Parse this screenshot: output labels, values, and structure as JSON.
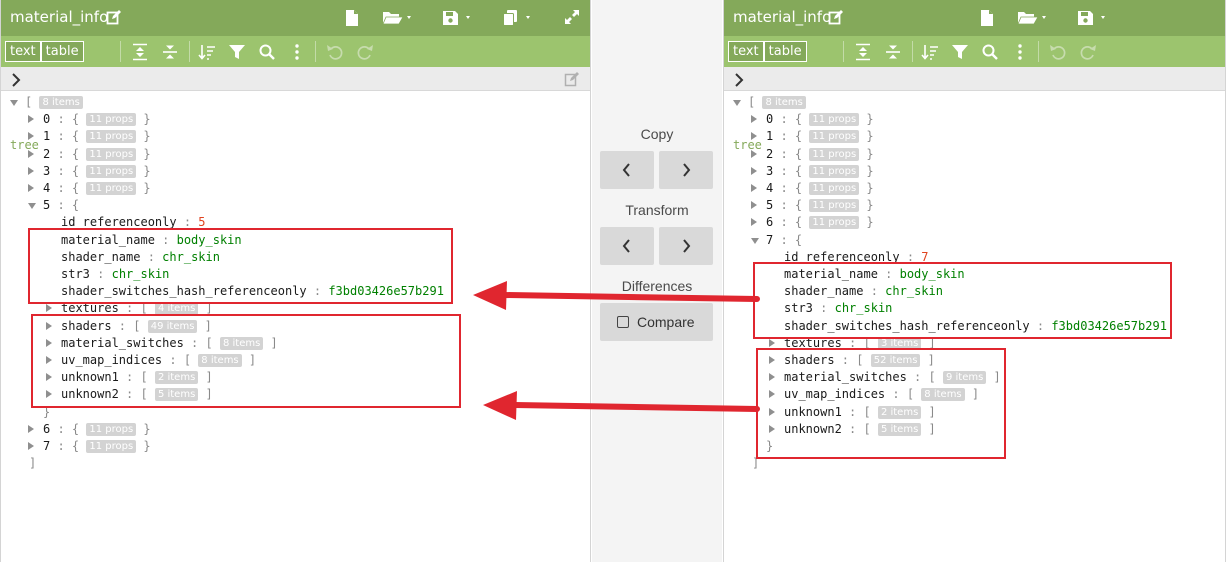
{
  "left": {
    "title": "material_info",
    "modes": {
      "text": "text",
      "tree": "tree",
      "table": "table"
    },
    "root_count": "8 items",
    "items_collapsed_before": [
      {
        "key": "0",
        "badge": "11 props"
      },
      {
        "key": "1",
        "badge": "11 props"
      },
      {
        "key": "2",
        "badge": "11 props"
      },
      {
        "key": "3",
        "badge": "11 props"
      },
      {
        "key": "4",
        "badge": "11 props"
      }
    ],
    "expanded": {
      "key": "5",
      "fields": [
        {
          "key": "id_referenceonly",
          "value": "5",
          "type": "num"
        },
        {
          "key": "material_name",
          "value": "body_skin",
          "type": "str"
        },
        {
          "key": "shader_name",
          "value": "chr_skin",
          "type": "str"
        },
        {
          "key": "str3",
          "value": "chr_skin",
          "type": "str"
        },
        {
          "key": "shader_switches_hash_referenceonly",
          "value": "f3bd03426e57b291",
          "type": "str"
        }
      ],
      "arrays": [
        {
          "key": "textures",
          "badge": "4 items"
        },
        {
          "key": "shaders",
          "badge": "49 items"
        },
        {
          "key": "material_switches",
          "badge": "8 items"
        },
        {
          "key": "uv_map_indices",
          "badge": "8 items"
        },
        {
          "key": "unknown1",
          "badge": "2 items"
        },
        {
          "key": "unknown2",
          "badge": "5 items"
        }
      ]
    },
    "items_collapsed_after": [
      {
        "key": "6",
        "badge": "11 props"
      },
      {
        "key": "7",
        "badge": "11 props"
      }
    ]
  },
  "right": {
    "title": "material_info",
    "modes": {
      "text": "text",
      "tree": "tree",
      "table": "table"
    },
    "root_count": "8 items",
    "items_collapsed_before": [
      {
        "key": "0",
        "badge": "11 props"
      },
      {
        "key": "1",
        "badge": "11 props"
      },
      {
        "key": "2",
        "badge": "11 props"
      },
      {
        "key": "3",
        "badge": "11 props"
      },
      {
        "key": "4",
        "badge": "11 props"
      },
      {
        "key": "5",
        "badge": "11 props"
      },
      {
        "key": "6",
        "badge": "11 props"
      }
    ],
    "expanded": {
      "key": "7",
      "fields": [
        {
          "key": "id_referenceonly",
          "value": "7",
          "type": "num"
        },
        {
          "key": "material_name",
          "value": "body_skin",
          "type": "str"
        },
        {
          "key": "shader_name",
          "value": "chr_skin",
          "type": "str"
        },
        {
          "key": "str3",
          "value": "chr_skin",
          "type": "str"
        },
        {
          "key": "shader_switches_hash_referenceonly",
          "value": "f3bd03426e57b291",
          "type": "str"
        }
      ],
      "arrays": [
        {
          "key": "textures",
          "badge": "3 items"
        },
        {
          "key": "shaders",
          "badge": "52 items"
        },
        {
          "key": "material_switches",
          "badge": "9 items"
        },
        {
          "key": "uv_map_indices",
          "badge": "8 items"
        },
        {
          "key": "unknown1",
          "badge": "2 items"
        },
        {
          "key": "unknown2",
          "badge": "5 items"
        }
      ]
    },
    "items_collapsed_after": []
  },
  "middle": {
    "copy_label": "Copy",
    "transform_label": "Transform",
    "differences_label": "Differences",
    "compare_label": "Compare"
  },
  "colors": {
    "header": "#84a95a",
    "toolbar": "#9cc46e",
    "annotation": "#e0262f"
  },
  "icons": [
    "edit-icon",
    "new-document-icon",
    "open-folder-icon",
    "save-icon",
    "copy-icon",
    "fullscreen-icon",
    "expand-all-icon",
    "collapse-all-icon",
    "sort-icon",
    "filter-icon",
    "search-icon",
    "more-icon",
    "undo-icon",
    "redo-icon",
    "chevron-right-icon",
    "chevron-left-icon"
  ]
}
